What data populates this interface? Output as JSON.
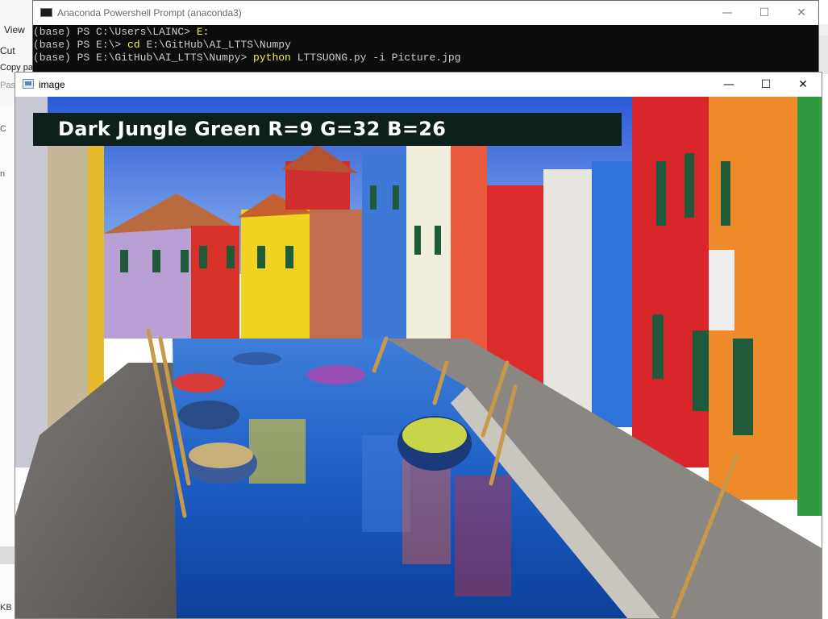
{
  "background_app": {
    "ribbon_items": [
      "View",
      "Cut",
      "Copy pa",
      "Past"
    ],
    "size_suffix": "KB",
    "misc": [
      "C",
      "n"
    ]
  },
  "console": {
    "title": "Anaconda Powershell Prompt (anaconda3)",
    "minimize_glyph": "—",
    "maximize_glyph": "☐",
    "close_glyph": "✕",
    "lines": [
      {
        "prompt": "(base) PS C:\\Users\\LAINC> ",
        "cmd": "E:",
        "args": ""
      },
      {
        "prompt": "(base) PS E:\\> ",
        "cmd": "cd",
        "args": " E:\\GitHub\\AI_LTTS\\Numpy"
      },
      {
        "prompt": "(base) PS E:\\GitHub\\AI_LTTS\\Numpy> ",
        "cmd": "python",
        "args": " LTTSUONG.py -i Picture.jpg"
      }
    ]
  },
  "image_window": {
    "title": "image",
    "minimize_glyph": "—",
    "maximize_glyph": "☐",
    "close_glyph": "✕",
    "detected_color_text": "Dark Jungle Green R=9 G=32 B=26",
    "banner_color": "#0e201b",
    "photo_description_icon": "photo-canvas"
  }
}
